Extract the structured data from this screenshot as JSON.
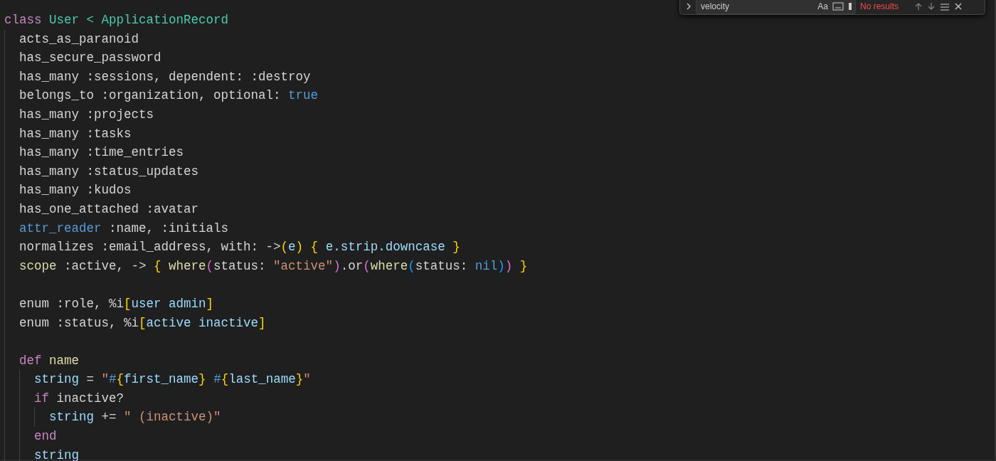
{
  "find_widget": {
    "query": "velocity",
    "match_case_label": "Aa",
    "result": "No results"
  },
  "editor": {
    "lines": [
      {
        "tokens": [
          {
            "t": "class",
            "color": "#c586c0"
          },
          {
            "t": " User < ApplicationRecord",
            "color": "#4ec9b0"
          }
        ],
        "children": [
          {
            "tokens": [
              {
                "t": "acts_as_paranoid"
              }
            ]
          },
          {
            "tokens": [
              {
                "t": "has_secure_password"
              }
            ]
          },
          {
            "tokens": [
              {
                "t": "has_many :sessions, dependent: :destroy"
              }
            ]
          },
          {
            "tokens": [
              {
                "t": "belongs_to :organization, optional: "
              },
              {
                "t": "true",
                "color": "#569cd6"
              }
            ]
          },
          {
            "tokens": [
              {
                "t": "has_many :projects"
              }
            ]
          },
          {
            "tokens": [
              {
                "t": "has_many :tasks"
              }
            ]
          },
          {
            "tokens": [
              {
                "t": "has_many :time_entries"
              }
            ]
          },
          {
            "tokens": [
              {
                "t": "has_many :status_updates"
              }
            ]
          },
          {
            "tokens": [
              {
                "t": "has_many :kudos"
              }
            ]
          },
          {
            "tokens": [
              {
                "t": "has_one_attached :avatar"
              }
            ]
          },
          {
            "tokens": [
              {
                "t": "attr_reader",
                "color": "#569cd6"
              },
              {
                "t": " :name, :initials"
              }
            ]
          },
          {
            "tokens": [
              {
                "t": "normalizes :email_address, with: ->"
              },
              {
                "t": "(",
                "color": "#ffd700"
              },
              {
                "t": "e",
                "color": "#9cdcfe"
              },
              {
                "t": ")",
                "color": "#ffd700"
              },
              {
                "t": " {",
                "color": "#ffd700"
              },
              {
                "t": " e.strip.downcase",
                "color": "#9cdcfe"
              },
              {
                "t": " }",
                "color": "#ffd700"
              }
            ]
          },
          {
            "tokens": [
              {
                "t": "scope",
                "color": "#dcdcaa"
              },
              {
                "t": " :active, -> "
              },
              {
                "t": "{",
                "color": "#ffd700"
              },
              {
                "t": " where",
                "color": "#dcdcaa"
              },
              {
                "t": "(",
                "color": "#da70d6"
              },
              {
                "t": "status: "
              },
              {
                "t": "\"active\"",
                "color": "#ce9178"
              },
              {
                "t": ")",
                "color": "#da70d6"
              },
              {
                "t": ".or"
              },
              {
                "t": "(",
                "color": "#da70d6"
              },
              {
                "t": "where",
                "color": "#dcdcaa"
              },
              {
                "t": "(",
                "color": "#179fff"
              },
              {
                "t": "status: "
              },
              {
                "t": "nil",
                "color": "#569cd6"
              },
              {
                "t": ")",
                "color": "#179fff"
              },
              {
                "t": ")",
                "color": "#da70d6"
              },
              {
                "t": " }",
                "color": "#ffd700"
              }
            ]
          },
          {
            "gap_before": true,
            "tokens": [
              {
                "t": "enum :role, %i"
              },
              {
                "t": "[",
                "color": "#ffd700"
              },
              {
                "t": "user admin",
                "color": "#9cdcfe"
              },
              {
                "t": "]",
                "color": "#ffd700"
              }
            ]
          },
          {
            "tokens": [
              {
                "t": "enum :status, %i"
              },
              {
                "t": "[",
                "color": "#ffd700"
              },
              {
                "t": "active inactive",
                "color": "#9cdcfe"
              },
              {
                "t": "]",
                "color": "#ffd700"
              }
            ]
          },
          {
            "gap_before": true,
            "tokens": [
              {
                "t": "def",
                "color": "#c586c0"
              },
              {
                "t": " name",
                "color": "#dcdcaa"
              }
            ],
            "children": [
              {
                "tokens": [
                  {
                    "t": "string",
                    "color": "#9cdcfe"
                  },
                  {
                    "t": " = "
                  },
                  {
                    "t": "\"",
                    "color": "#ce9178"
                  },
                  {
                    "t": "#",
                    "color": "#569cd6"
                  },
                  {
                    "t": "{",
                    "color": "#ffd700"
                  },
                  {
                    "t": "first_name",
                    "color": "#9cdcfe"
                  },
                  {
                    "t": "}",
                    "color": "#ffd700"
                  },
                  {
                    "t": " #",
                    "color": "#569cd6"
                  },
                  {
                    "t": "{",
                    "color": "#ffd700"
                  },
                  {
                    "t": "last_name",
                    "color": "#9cdcfe"
                  },
                  {
                    "t": "}",
                    "color": "#ffd700"
                  },
                  {
                    "t": "\"",
                    "color": "#ce9178"
                  }
                ]
              },
              {
                "tokens": [
                  {
                    "t": "if",
                    "color": "#c586c0"
                  },
                  {
                    "t": " inactive?"
                  }
                ],
                "children": [
                  {
                    "tokens": [
                      {
                        "t": "string",
                        "color": "#9cdcfe"
                      },
                      {
                        "t": " += "
                      },
                      {
                        "t": "\" (inactive)\"",
                        "color": "#ce9178"
                      }
                    ]
                  }
                ]
              },
              {
                "tokens": [
                  {
                    "t": "end",
                    "color": "#c586c0"
                  }
                ]
              },
              {
                "tokens": [
                  {
                    "t": "string",
                    "color": "#9cdcfe"
                  }
                ]
              }
            ]
          }
        ]
      }
    ]
  }
}
